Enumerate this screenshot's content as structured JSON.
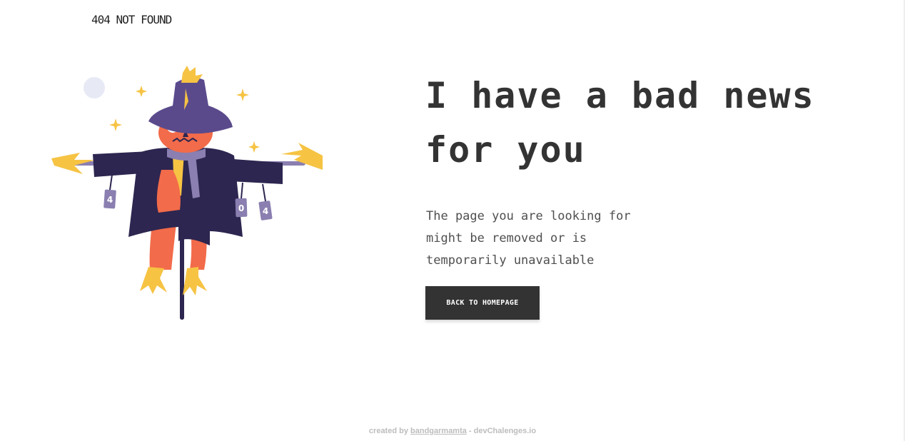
{
  "header": {
    "logo_text": "404 NOT FOUND"
  },
  "main": {
    "headline": "I have a bad news for you",
    "description": "The page you are looking for might be removed or is temporarily unavailable",
    "button_label": "BACK TO HOMEPAGE"
  },
  "illustration": {
    "icon_name": "scarecrow-404-illustration",
    "can_labels": [
      "4",
      "0",
      "4"
    ],
    "colors": {
      "hat": "#5a4a8c",
      "coat": "#2d2650",
      "face": "#f26b4a",
      "straw": "#f6c343",
      "scarf": "#8a7fb0",
      "moon": "#e7e9f5",
      "pole": "#2d2650"
    }
  },
  "footer": {
    "prefix": "created by",
    "author": "bandgarmamta",
    "separator": " - ",
    "site": "devChalenges.io"
  },
  "colors": {
    "text": "#333333",
    "button_bg": "#333333",
    "button_text": "#ffffff",
    "footer_text": "#bdbdbd"
  }
}
